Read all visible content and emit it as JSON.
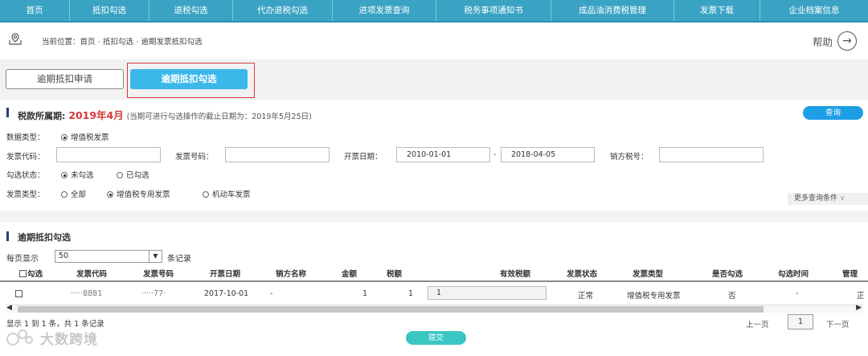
{
  "nav": {
    "items": [
      "首页",
      "抵扣勾选",
      "退税勾选",
      "代办退税勾选",
      "进项发票查询",
      "税务事项通知书",
      "成品油消费税管理",
      "发票下载",
      "企业档案信息"
    ]
  },
  "breadcrumb": {
    "label": "当前位置：",
    "home": "首页",
    "sep": " - ",
    "level1": "抵扣勾选",
    "level2": "逾期发票抵扣勾选"
  },
  "help": {
    "label": "帮助"
  },
  "tabs": {
    "apply": "逾期抵扣申请",
    "select": "逾期抵扣勾选"
  },
  "query": {
    "title": "税款所属期:",
    "period": "2019年4月",
    "period_note": "(当期可进行勾选操作的截止日期为：2019年5月25日)",
    "query_button": "查询",
    "data_type_label": "数据类型：",
    "data_type_option": "增值税发票",
    "invoice_code_label": "发票代码：",
    "invoice_code_value": "",
    "invoice_no_label": "发票号码：",
    "invoice_no_value": "",
    "date_label": "开票日期：",
    "date_from": "2010-01-01",
    "date_dash": "-",
    "date_to": "2018-04-05",
    "seller_tax_label": "销方税号：",
    "seller_tax_value": "",
    "status_label": "勾选状态：",
    "status_opt1": "未勾选",
    "status_opt2": "已勾选",
    "invoice_type_label": "发票类型：",
    "type_opt1": "全部",
    "type_opt2": "增值税专用发票",
    "type_opt3": "机动车发票",
    "more": "更多查询条件"
  },
  "results": {
    "title": "逾期抵扣勾选",
    "page_size_label": "每页显示",
    "page_size_value": "50",
    "page_size_unit": "条记录",
    "columns": [
      "勾选",
      "发票代码",
      "发票号码",
      "开票日期",
      "销方名称",
      "金额",
      "税额",
      "有效税额",
      "发票状态",
      "发票类型",
      "是否勾选",
      "勾选时间",
      "管理"
    ],
    "row": {
      "invoice_code": "·····8881",
      "invoice_no": "·····77·",
      "date": "2017-10-01",
      "seller": "-",
      "amount": "1",
      "tax": "1",
      "valid_tax": "1",
      "status": "正常",
      "type": "增值税专用发票",
      "selected": "否",
      "select_time": "-",
      "manage": "正"
    },
    "summary": "显示 1 到 1 条，共 1 条记录",
    "prev": "上一页",
    "page": "1",
    "next": "下一页",
    "submit": "提交"
  },
  "watermark": {
    "text": "大数跨境"
  },
  "colors": {
    "nav_bg": "#3aa3c4",
    "accent_blue": "#3ab8ea",
    "query_blue": "#1e9ee6",
    "highlight_red": "#d9383a",
    "submit_teal": "#3ac7c4"
  }
}
